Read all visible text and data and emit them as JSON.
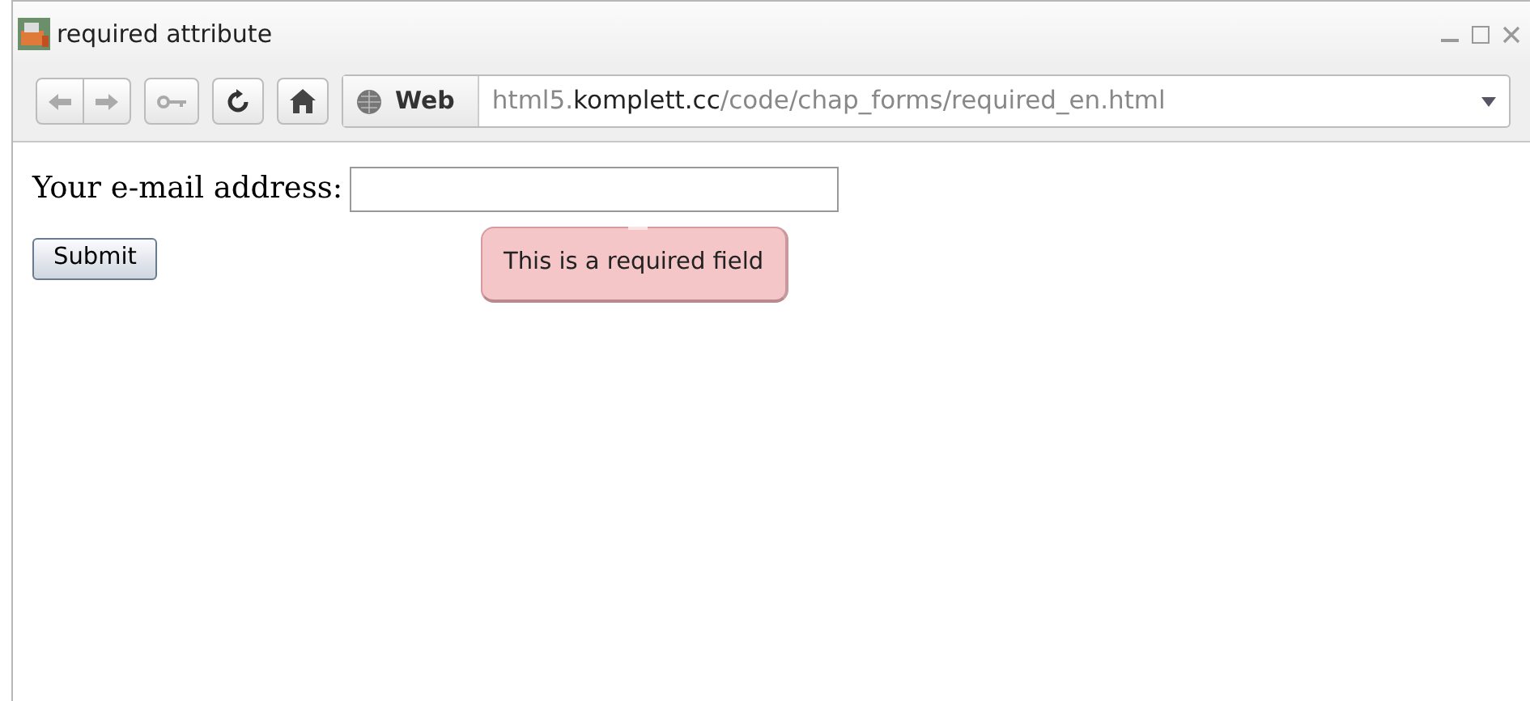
{
  "window": {
    "title": "required attribute"
  },
  "toolbar": {
    "zone": "Web",
    "url": [
      {
        "kind": "dim",
        "text": "html5."
      },
      {
        "kind": "host",
        "text": "komplett.cc"
      },
      {
        "kind": "dim",
        "text": "/code/chap_forms/required_en.html"
      }
    ]
  },
  "form": {
    "label": "Your e-mail address:",
    "button": "Submit",
    "tooltip": "This is a required field"
  }
}
